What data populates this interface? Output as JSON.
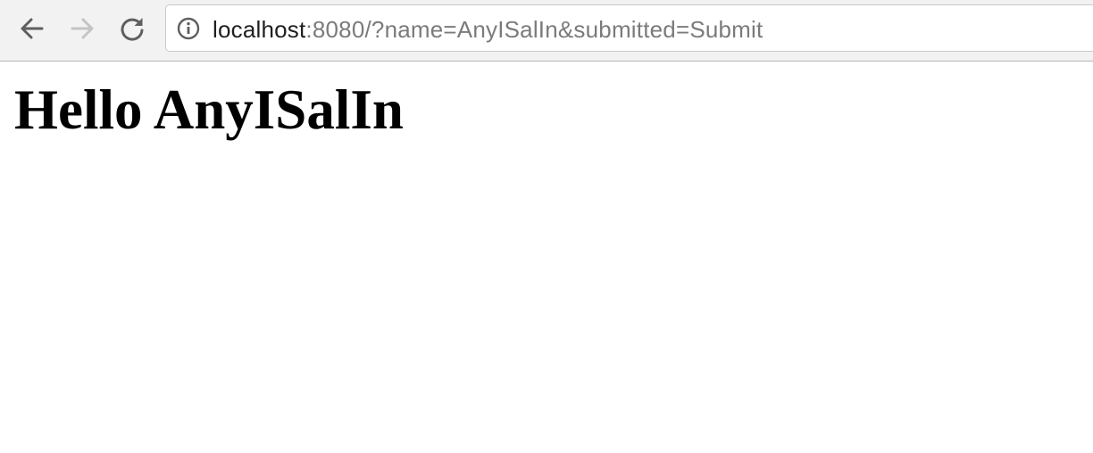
{
  "browser": {
    "toolbar": {
      "back_icon": "arrow-left-icon",
      "forward_icon": "arrow-right-icon",
      "reload_icon": "reload-icon",
      "forward_enabled": false
    },
    "address_bar": {
      "info_icon": "info-icon",
      "url_host": "localhost",
      "url_rest": ":8080/?name=AnyISalIn&submitted=Submit"
    }
  },
  "page": {
    "heading": "Hello AnyISalIn"
  },
  "colors": {
    "toolbar_bg": "#f2f2f2",
    "url_host": "#1f1f1f",
    "url_rest": "#7b7b7b",
    "icon_active": "#5f5f5f",
    "icon_disabled": "#c4c4c4"
  }
}
